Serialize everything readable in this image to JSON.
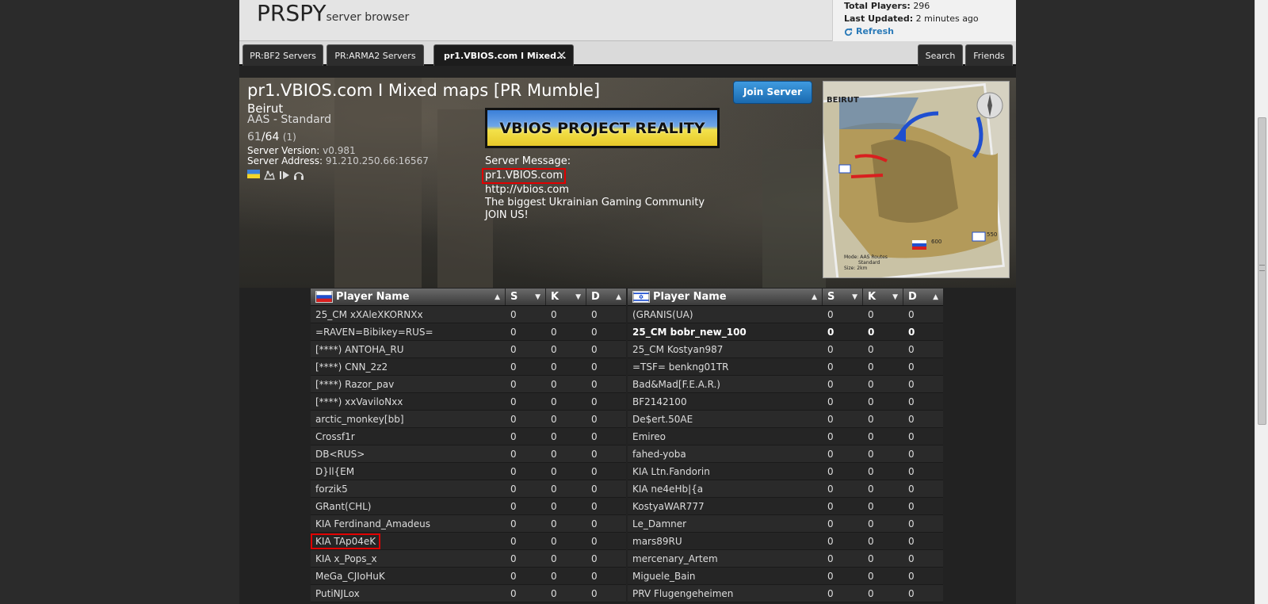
{
  "header": {
    "logo": "PRSPY",
    "logo_sub": "server browser",
    "total_players_label": "Total Players:",
    "total_players": "296",
    "last_updated_label": "Last Updated:",
    "last_updated": "2 minutes ago",
    "refresh": "Refresh"
  },
  "tabs": [
    {
      "label": "PR:BF2 Servers"
    },
    {
      "label": "PR:ARMA2 Servers"
    },
    {
      "label": "pr1.VBIOS.com I Mixed..."
    }
  ],
  "right_tabs": [
    {
      "label": "Search"
    },
    {
      "label": "Friends"
    }
  ],
  "server": {
    "title": "pr1.VBIOS.com I Mixed maps [PR Mumble]",
    "map": "Beirut",
    "mode": "AAS - Standard",
    "players_current": "61",
    "players_max": "/64",
    "players_queue": "(1)",
    "version_label": "Server Version:",
    "version": "v0.981",
    "address_label": "Server Address:",
    "address": "91.210.250.66:16567",
    "join_label": "Join Server",
    "banner_text": "VBIOS PROJECT REALITY",
    "message_label": "Server Message:",
    "message_lines": [
      "pr1.VBIOS.com",
      "http://vbios.com",
      "The biggest Ukrainian Gaming Community",
      "JOIN US!"
    ]
  },
  "map_preview": {
    "title": "BEIRUT",
    "tickets_left": "600",
    "tickets_right": "550",
    "mode_line": "Mode: AAS Routes",
    "mode_line2": "Standard",
    "size": "Size: 2km"
  },
  "table_headers": {
    "name": "Player Name",
    "s": "S",
    "k": "K",
    "d": "D"
  },
  "team1": [
    {
      "name": "25_CM xXAleXKORNXx",
      "s": "0",
      "k": "0",
      "d": "0"
    },
    {
      "name": "=RAVEN=Bibikey=RUS=",
      "s": "0",
      "k": "0",
      "d": "0"
    },
    {
      "name": "[****) ANTOHA_RU",
      "s": "0",
      "k": "0",
      "d": "0"
    },
    {
      "name": "[****) CNN_2z2",
      "s": "0",
      "k": "0",
      "d": "0"
    },
    {
      "name": "[****) Razor_pav",
      "s": "0",
      "k": "0",
      "d": "0"
    },
    {
      "name": "[****) xxVaviloNxx",
      "s": "0",
      "k": "0",
      "d": "0"
    },
    {
      "name": "arctic_monkey[bb]",
      "s": "0",
      "k": "0",
      "d": "0"
    },
    {
      "name": "Crossf1r",
      "s": "0",
      "k": "0",
      "d": "0"
    },
    {
      "name": "DB<RUS>",
      "s": "0",
      "k": "0",
      "d": "0"
    },
    {
      "name": "D}ll{EM",
      "s": "0",
      "k": "0",
      "d": "0"
    },
    {
      "name": "forzik5",
      "s": "0",
      "k": "0",
      "d": "0"
    },
    {
      "name": "GRant(CHL)",
      "s": "0",
      "k": "0",
      "d": "0"
    },
    {
      "name": "KIA Ferdinand_Amadeus",
      "s": "0",
      "k": "0",
      "d": "0"
    },
    {
      "name": "KIA TAp04eK",
      "s": "0",
      "k": "0",
      "d": "0"
    },
    {
      "name": "KIA x_Pops_x",
      "s": "0",
      "k": "0",
      "d": "0"
    },
    {
      "name": "MeGa_CJIoHuK",
      "s": "0",
      "k": "0",
      "d": "0"
    },
    {
      "name": "PutiNJLox",
      "s": "0",
      "k": "0",
      "d": "0"
    }
  ],
  "team2": [
    {
      "name": "(GRANIS(UA)",
      "s": "0",
      "k": "0",
      "d": "0"
    },
    {
      "name": "25_CM bobr_new_100",
      "s": "0",
      "k": "0",
      "d": "0"
    },
    {
      "name": "25_CM Kostyan987",
      "s": "0",
      "k": "0",
      "d": "0"
    },
    {
      "name": "=TSF= benkng01TR",
      "s": "0",
      "k": "0",
      "d": "0"
    },
    {
      "name": "Bad&Mad[F.E.A.R.)",
      "s": "0",
      "k": "0",
      "d": "0"
    },
    {
      "name": "BF2142100",
      "s": "0",
      "k": "0",
      "d": "0"
    },
    {
      "name": "De$ert.50AE",
      "s": "0",
      "k": "0",
      "d": "0"
    },
    {
      "name": "Emireo",
      "s": "0",
      "k": "0",
      "d": "0"
    },
    {
      "name": "fahed-yoba",
      "s": "0",
      "k": "0",
      "d": "0"
    },
    {
      "name": "KIA Ltn.Fandorin",
      "s": "0",
      "k": "0",
      "d": "0"
    },
    {
      "name": "KIA ne4eHb|{a",
      "s": "0",
      "k": "0",
      "d": "0"
    },
    {
      "name": "KostyaWAR777",
      "s": "0",
      "k": "0",
      "d": "0"
    },
    {
      "name": "Le_Damner",
      "s": "0",
      "k": "0",
      "d": "0"
    },
    {
      "name": "mars89RU",
      "s": "0",
      "k": "0",
      "d": "0"
    },
    {
      "name": "mercenary_Artem",
      "s": "0",
      "k": "0",
      "d": "0"
    },
    {
      "name": "Miguele_Bain",
      "s": "0",
      "k": "0",
      "d": "0"
    },
    {
      "name": "PRV Flugengeheimen",
      "s": "0",
      "k": "0",
      "d": "0"
    }
  ],
  "colors": {
    "accent": "#2a7ab8",
    "highlight": "#e00000",
    "join": "#1a6ab0"
  },
  "icons": [
    "ukraine-flag-icon",
    "vehicles-icon",
    "battlerecorder-icon",
    "mumble-icon",
    "refresh-icon",
    "russia-flag-icon",
    "israel-flag-icon"
  ]
}
